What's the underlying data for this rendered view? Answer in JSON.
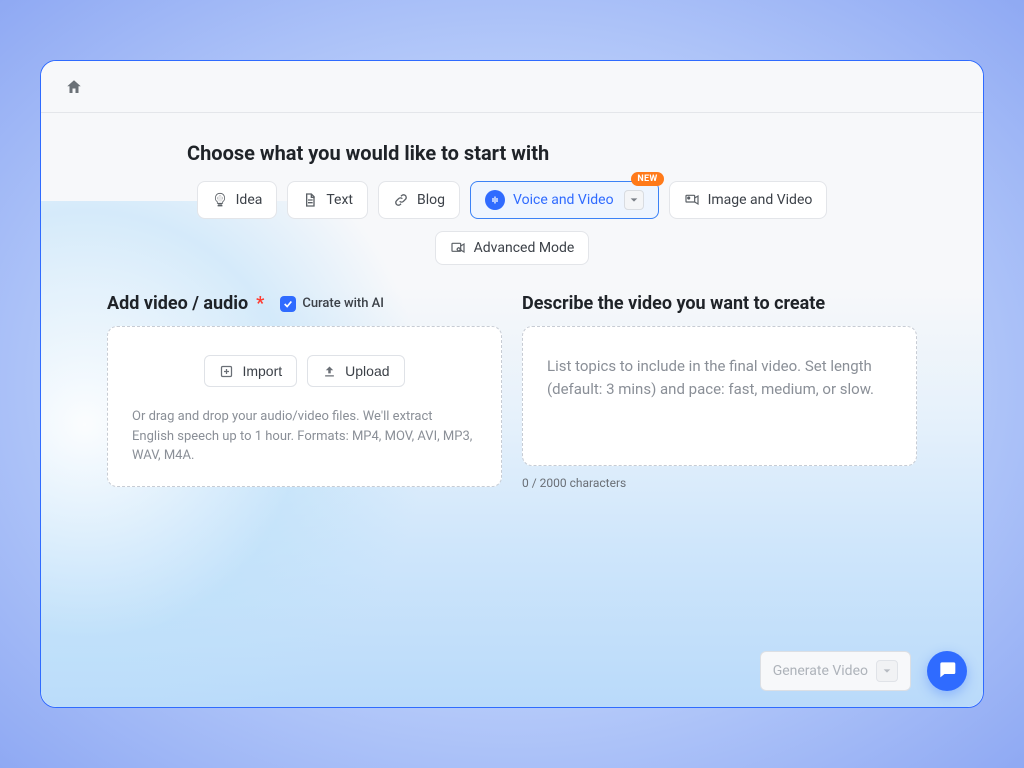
{
  "page": {
    "title": "Choose what you would like to start with"
  },
  "tabs": {
    "idea": "Idea",
    "text": "Text",
    "blog": "Blog",
    "voice_video": "Voice and Video",
    "image_video": "Image and Video",
    "advanced": "Advanced Mode",
    "new_badge": "NEW"
  },
  "left": {
    "title": "Add video / audio",
    "required_marker": "*",
    "curate_label": "Curate with AI",
    "import_btn": "Import",
    "upload_btn": "Upload",
    "hint": "Or drag and drop your audio/video files. We'll extract English speech up to 1 hour. Formats: MP4, MOV, AVI, MP3, WAV, M4A."
  },
  "right": {
    "title": "Describe the video you want to create",
    "placeholder": "List topics to include in the final video. Set length (default: 3 mins) and pace: fast, medium, or slow.",
    "counter": "0 / 2000 characters"
  },
  "footer": {
    "generate": "Generate Video"
  }
}
